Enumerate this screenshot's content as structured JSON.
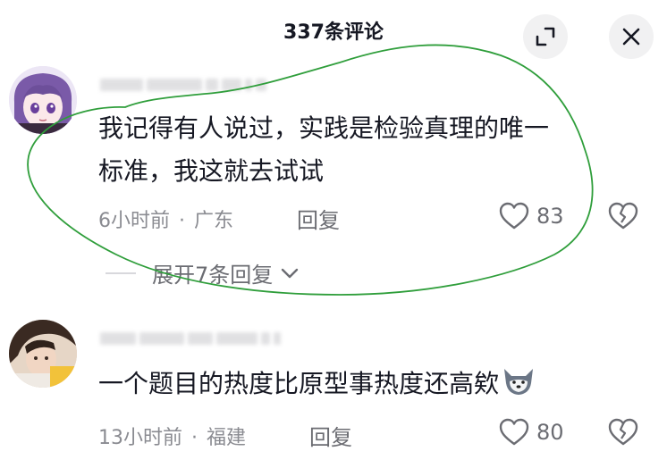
{
  "header": {
    "title": "337条评论",
    "expand_icon": "expand-arrows-icon",
    "close_icon": "close-icon"
  },
  "comments": [
    {
      "text_line1": "我记得有人说过，实践是检验真理的唯一",
      "text_line2": "标准，我这就去试试",
      "time": "6小时前",
      "location": "广东",
      "reply_label": "回复",
      "likes": "83",
      "expand_replies": "展开7条回复"
    },
    {
      "text": "一个题目的热度比原型事热度还高欸",
      "time": "13小时前",
      "location": "福建",
      "reply_label": "回复",
      "likes": "80"
    }
  ],
  "colors": {
    "annotation_circle": "#2f9e3b",
    "meta_text": "#8a8b91",
    "primary_text": "#161823"
  }
}
